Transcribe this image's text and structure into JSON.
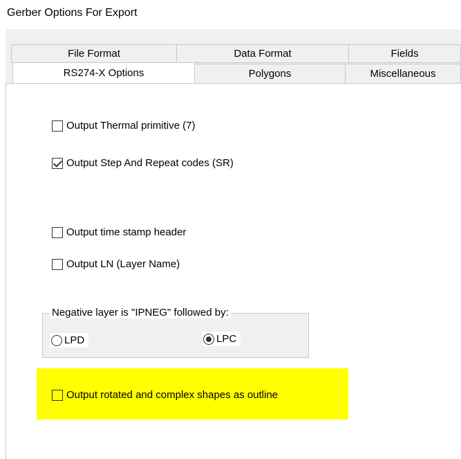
{
  "window": {
    "title": "Gerber Options For Export"
  },
  "tabs": {
    "back_row": [
      "File Format",
      "Data Format",
      "Fields"
    ],
    "front_row": [
      "RS274-X Options",
      "Polygons",
      "Miscellaneous"
    ],
    "selected": "RS274-X Options"
  },
  "options": {
    "thermal": {
      "label": "Output Thermal primitive (7)",
      "checked": false
    },
    "step_repeat": {
      "label": "Output Step And Repeat codes (SR)",
      "checked": true
    },
    "time_stamp": {
      "label": "Output time stamp header",
      "checked": false
    },
    "layer_name": {
      "label": "Output LN (Layer Name)",
      "checked": false
    },
    "rotated_outline": {
      "label": "Output rotated and complex shapes as outline",
      "checked": false
    }
  },
  "negative_group": {
    "legend": "Negative layer is \"IPNEG\" followed by:",
    "options": [
      "LPD",
      "LPC"
    ],
    "selected": "LPC"
  },
  "colors": {
    "highlight": "#ffff00",
    "tab_background": "#f0f0f0",
    "panel_background": "#ffffff"
  }
}
